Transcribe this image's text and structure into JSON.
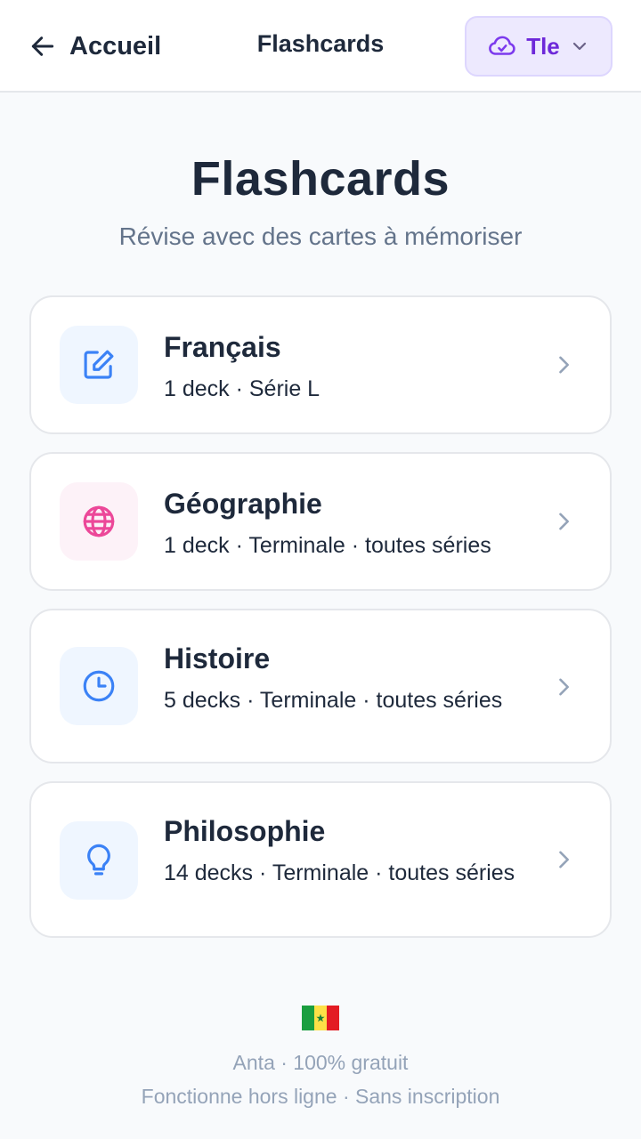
{
  "header": {
    "back_label": "Accueil",
    "title": "Flashcards",
    "level_label": "Tle"
  },
  "hero": {
    "title": "Flashcards",
    "subtitle": "Révise avec des cartes à mémoriser"
  },
  "subjects": [
    {
      "name": "Français",
      "meta": "1 deck · Série L",
      "icon": "edit-icon",
      "accent": "#3b82f6",
      "bg": "#eff6ff"
    },
    {
      "name": "Géographie",
      "meta": "1 deck · Terminale · toutes séries",
      "icon": "globe-icon",
      "accent": "#ec4899",
      "bg": "#fdf2f8"
    },
    {
      "name": "Histoire",
      "meta": "5 decks · Terminale · toutes séries",
      "icon": "clock-icon",
      "accent": "#3b82f6",
      "bg": "#eff6ff"
    },
    {
      "name": "Philosophie",
      "meta": "14 decks · Terminale · toutes séries",
      "icon": "lightbulb-icon",
      "accent": "#3b82f6",
      "bg": "#eff6ff"
    }
  ],
  "footer": {
    "flag_colors": [
      "#1a9e3f",
      "#fde047",
      "#e31b23"
    ],
    "line1": "Anta · 100% gratuit",
    "line2": "Fonctionne hors ligne · Sans inscription"
  },
  "colors": {
    "accent_purple": "#6d28d9",
    "text_dark": "#1e293b",
    "text_muted": "#64748b"
  }
}
